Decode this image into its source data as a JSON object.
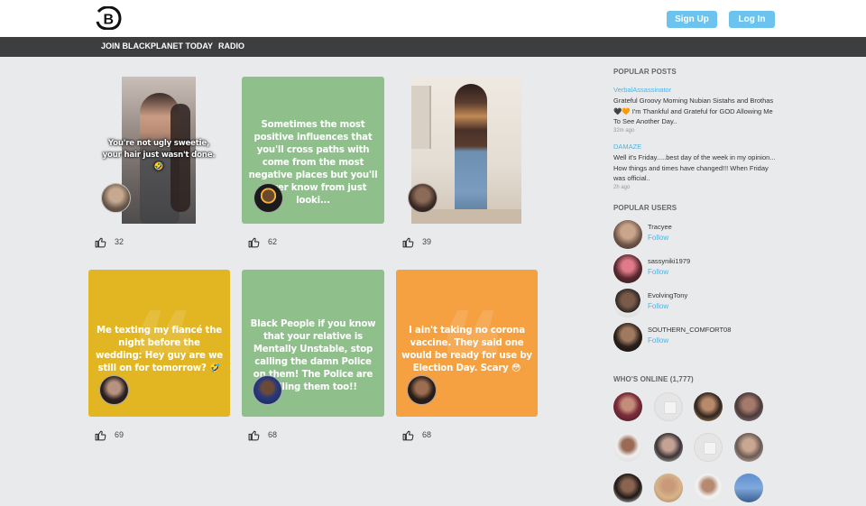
{
  "header": {
    "logo_icon": "blackplanet-logo-icon",
    "signup_label": "Sign Up",
    "login_label": "Log In"
  },
  "nav": {
    "join_label": "JOIN BLACKPLANET TODAY",
    "radio_label": "RADIO"
  },
  "feed": {
    "cards": [
      {
        "kind": "photo",
        "caption": "You're not ugly sweetie, your hair just wasn't done. 🤣",
        "likes": "32"
      },
      {
        "kind": "text",
        "color": "#8fc08c",
        "text": "Sometimes the most positive influences that you'll cross paths with come from the most negative places but you'll never know from just looki...",
        "likes": "62"
      },
      {
        "kind": "photo",
        "caption": "",
        "likes": "39"
      },
      {
        "kind": "text",
        "color": "#e2b623",
        "text": "Me texting my fiancé the night before the wedding: Hey guy are we still on for tomorrow? 🤣",
        "likes": "69"
      },
      {
        "kind": "text",
        "color": "#8fc08c",
        "text": "Black People if you know that your relative is Mentally Unstable, stop calling the damn Police on them! The Police are Killing them too!!",
        "likes": "68"
      },
      {
        "kind": "text",
        "color": "#f5a041",
        "text": "I ain't taking no corona vaccine. They said one would be ready for use by Election Day. Scary 😳",
        "likes": "68"
      }
    ],
    "like_icon": "thumbs-up-icon"
  },
  "sidebar": {
    "popular_posts_heading": "POPULAR POSTS",
    "posts": [
      {
        "author": "VerbalAssassinator",
        "text": "Grateful Groovy Morning Nubian Sistahs and Brothas 🖤🧡 I'm Thankful and Grateful for GOD Allowing Me To See Another Day..",
        "time": "32m ago"
      },
      {
        "author": "DAMAZE",
        "text": "Well it's Friday.....best day of the week in my opinion... How things and times have changed!!! When Friday was official..",
        "time": "2h ago"
      }
    ],
    "popular_users_heading": "POPULAR USERS",
    "users": [
      {
        "name": "Tracyee",
        "follow": "Follow"
      },
      {
        "name": "sassyniki1979",
        "follow": "Follow"
      },
      {
        "name": "EvolvingTony",
        "follow": "Follow"
      },
      {
        "name": "SOUTHERN_COMFORT08",
        "follow": "Follow"
      }
    ],
    "online_heading": "WHO'S ONLINE (1,777)"
  },
  "colors": {
    "accent_blue": "#6cc3ee",
    "link_blue": "#4fb3e3",
    "nav_dark": "#3d3e40",
    "card_green": "#8fc08c",
    "card_yellow": "#e2b623",
    "card_orange": "#f5a041"
  }
}
